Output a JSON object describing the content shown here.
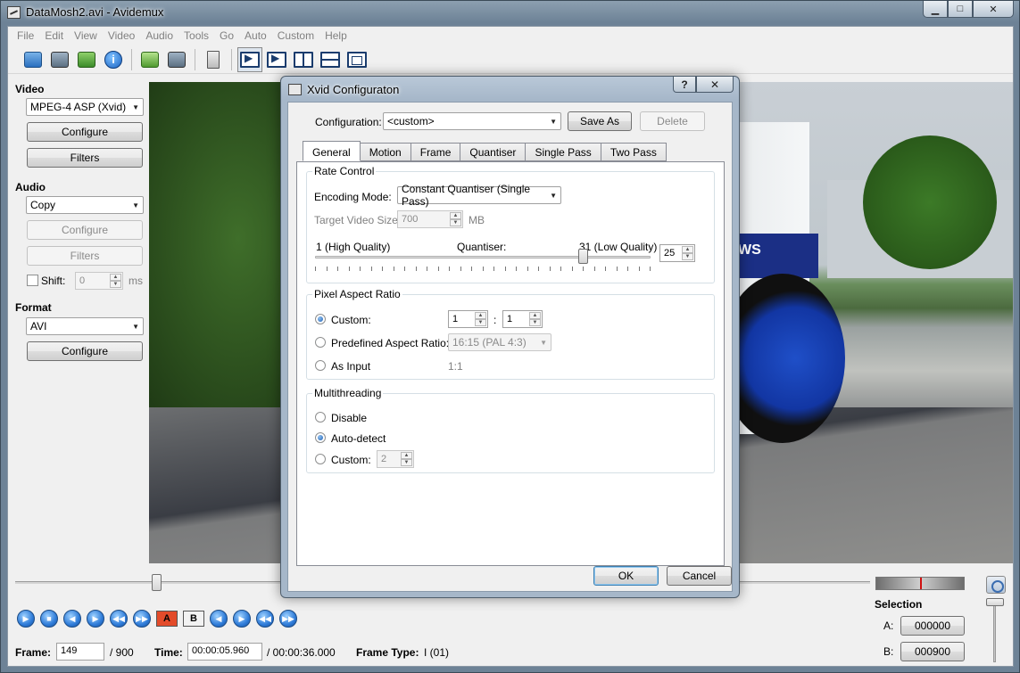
{
  "window": {
    "title": "DataMosh2.avi - Avidemux",
    "minimize_glyph": "▁",
    "maximize_glyph": "□",
    "close_glyph": "✕"
  },
  "menu": [
    "File",
    "Edit",
    "View",
    "Video",
    "Audio",
    "Tools",
    "Go",
    "Auto",
    "Custom",
    "Help"
  ],
  "toolbar_icons": [
    "open-icon",
    "save-icon",
    "append-icon",
    "info-icon",
    "open-folder-icon",
    "save-alt-icon",
    "calculator-icon",
    "layout-arrow-icon",
    "layout-arrow2-icon",
    "layout-vsplit-icon",
    "layout-hsplit-icon",
    "layout-single-icon"
  ],
  "video_panel": {
    "label": "Video",
    "codec": "MPEG-4 ASP (Xvid)",
    "configure": "Configure",
    "filters": "Filters"
  },
  "audio_panel": {
    "label": "Audio",
    "codec": "Copy",
    "configure": "Configure",
    "filters": "Filters",
    "shift_label": "Shift:",
    "shift_value": "0",
    "shift_unit": "ms"
  },
  "format_panel": {
    "label": "Format",
    "container": "AVI",
    "configure": "Configure"
  },
  "video_overlay_text": "WS",
  "timeline": {
    "position_fraction": 0.165
  },
  "transport": {
    "marker_a": "A",
    "marker_b": "B"
  },
  "status": {
    "frame_label": "Frame:",
    "frame_value": "149",
    "frame_total": "/ 900",
    "time_label": "Time:",
    "time_value": "00:00:05.960",
    "time_total": "/ 00:00:36.000",
    "frame_type_label": "Frame Type:",
    "frame_type_value": "I (01)"
  },
  "selection": {
    "label": "Selection",
    "a_label": "A:",
    "a_value": "000000",
    "b_label": "B:",
    "b_value": "000900"
  },
  "dialog": {
    "title": "Xvid Configuraton",
    "help_glyph": "?",
    "close_glyph": "✕",
    "configuration_label": "Configuration:",
    "configuration_value": "<custom>",
    "save_as": "Save As",
    "delete": "Delete",
    "tabs": [
      "General",
      "Motion",
      "Frame",
      "Quantiser",
      "Single Pass",
      "Two Pass"
    ],
    "rate_control": {
      "title": "Rate Control",
      "encoding_mode_label": "Encoding Mode:",
      "encoding_mode_value": "Constant Quantiser (Single Pass)",
      "target_size_label": "Target Video Size:",
      "target_size_value": "700",
      "target_size_unit": "MB",
      "q_min_label": "1 (High Quality)",
      "q_label": "Quantiser:",
      "q_max_label": "31 (Low Quality)",
      "q_value": "25",
      "q_min": 1,
      "q_max": 31,
      "q_current": 25
    },
    "pixel_aspect": {
      "title": "Pixel Aspect Ratio",
      "custom_label": "Custom:",
      "custom_num": "1",
      "custom_sep": ":",
      "custom_den": "1",
      "predefined_label": "Predefined Aspect Ratio:",
      "predefined_value": "16:15 (PAL 4:3)",
      "as_input_label": "As Input",
      "as_input_value": "1:1"
    },
    "multithreading": {
      "title": "Multithreading",
      "disable_label": "Disable",
      "auto_label": "Auto-detect",
      "custom_label": "Custom:",
      "custom_value": "2"
    },
    "ok": "OK",
    "cancel": "Cancel"
  }
}
